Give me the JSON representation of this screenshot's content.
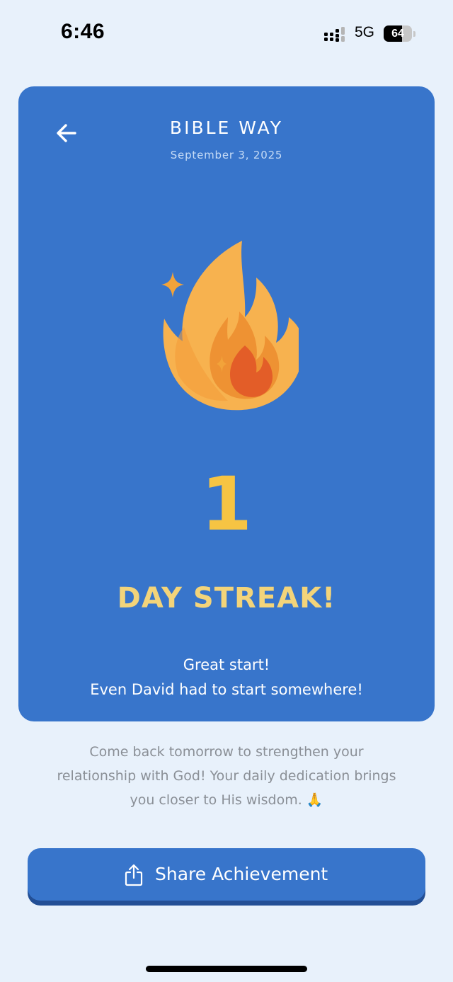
{
  "status_bar": {
    "time": "6:46",
    "network": "5G",
    "battery_percent": "64",
    "battery_level": 0.64,
    "signal_icon": "cellular-signal-icon"
  },
  "card": {
    "title": "BIBLE WAY",
    "date": "September 3, 2025",
    "back_icon": "arrow-left-icon",
    "flame_icon": "flame-icon",
    "streak_count": "1",
    "streak_label": "DAY STREAK!",
    "message_lines": [
      "Great start!",
      "Even David had to start somewhere!"
    ]
  },
  "info_lines": [
    "Come back tomorrow to strengthen your",
    "relationship with God! Your daily dedication brings",
    "you closer to His wisdom. 🙏"
  ],
  "share_button": {
    "label": "Share Achievement",
    "icon": "share-icon"
  },
  "colors": {
    "background": "#e8f1fb",
    "card": "#3875cb",
    "streak_number": "#f6c443",
    "streak_label": "#f3d47a",
    "button_shadow": "#234f95",
    "info_text": "#8a8f96"
  }
}
